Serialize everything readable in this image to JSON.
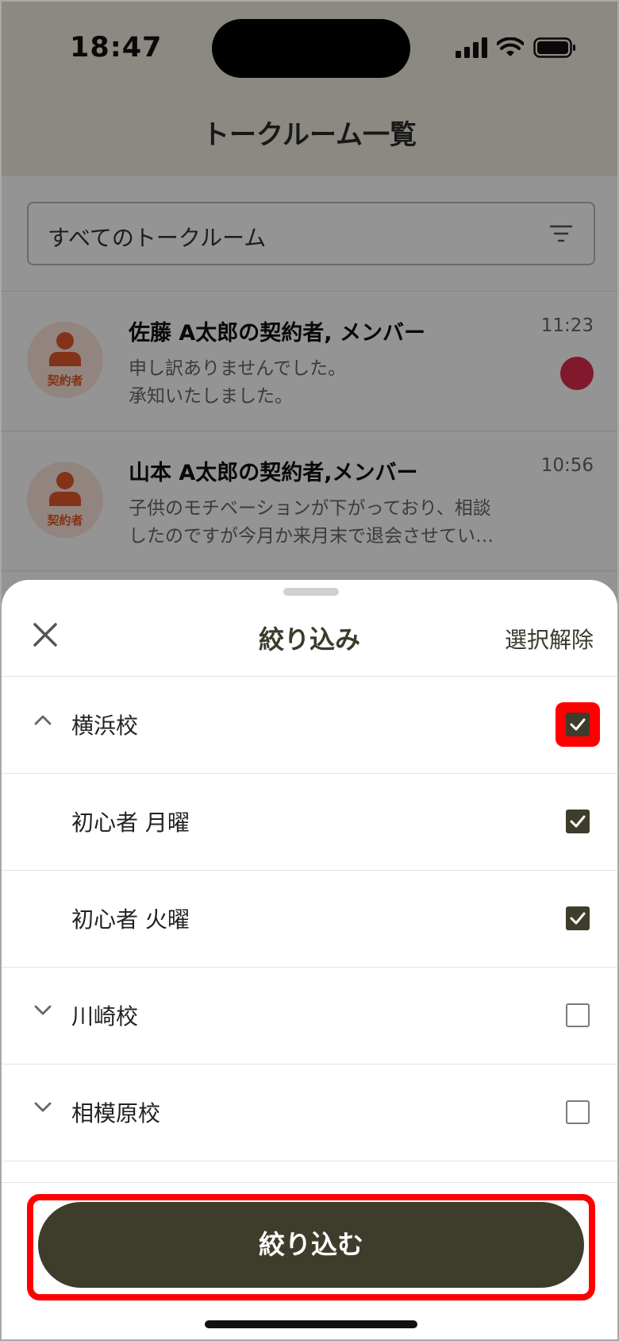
{
  "status_bar": {
    "time": "18:47"
  },
  "header": {
    "title": "トークルーム一覧"
  },
  "filter": {
    "label": "すべてのトークルーム",
    "icon": "filter-icon"
  },
  "chats": [
    {
      "avatar_label": "契約者",
      "name": "佐藤 A太郎の契約者, メンバー",
      "message_lines": [
        "申し訳ありませんでした。",
        "承知いたしました。"
      ],
      "time": "11:23",
      "unread": true
    },
    {
      "avatar_label": "契約者",
      "name": "山本 A太郎の契約者,メンバー",
      "message_lines": [
        "子供のモチベーションが下がっており、相談",
        "したのですが今月か来月末で退会させてい…"
      ],
      "time": "10:56",
      "unread": false
    }
  ],
  "sheet": {
    "title": "絞り込み",
    "clear_label": "選択解除",
    "options": [
      {
        "label": "横浜校",
        "chevron": "up",
        "checked": true,
        "highlighted": true
      },
      {
        "label": "初心者 月曜",
        "chevron": "none",
        "checked": true,
        "highlighted": false
      },
      {
        "label": "初心者 火曜",
        "chevron": "none",
        "checked": true,
        "highlighted": false
      },
      {
        "label": "川崎校",
        "chevron": "down",
        "checked": false,
        "highlighted": false
      },
      {
        "label": "相模原校",
        "chevron": "down",
        "checked": false,
        "highlighted": false
      }
    ],
    "apply_label": "絞り込む"
  },
  "colors": {
    "accent": "#3e3c2b",
    "highlight": "#ff0000",
    "unread": "#e02a4a",
    "avatar_bg": "#fbe5dc",
    "avatar_fg": "#e0582a"
  }
}
